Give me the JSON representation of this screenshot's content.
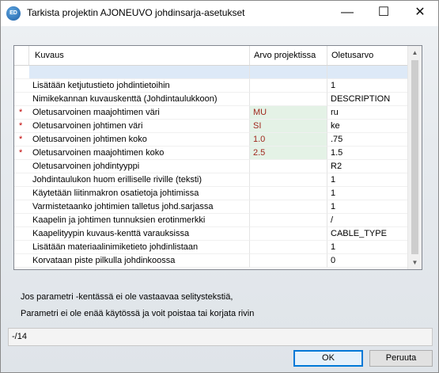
{
  "window": {
    "app_icon_text": "ED",
    "title": "Tarkista projektin AJONEUVO johdinsarja-asetukset",
    "minimize_glyph": "—",
    "maximize_glyph": "☐",
    "close_glyph": "✕"
  },
  "grid": {
    "headers": [
      "Kuvaus",
      "Arvo projektissa",
      "Oletusarvo"
    ],
    "rows": [
      {
        "flag": "",
        "desc": "",
        "project": "",
        "default": "",
        "modified": false
      },
      {
        "flag": "",
        "desc": "Lisätään ketjutustieto johdintietoihin",
        "project": "",
        "default": "1",
        "modified": false
      },
      {
        "flag": "",
        "desc": "Nimikekannan kuvauskenttä (Johdintaulukkoon)",
        "project": "",
        "default": "DESCRIPTION",
        "modified": false
      },
      {
        "flag": "*",
        "desc": "Oletusarvoinen maajohtimen väri",
        "project": "MU",
        "default": "ru",
        "modified": true
      },
      {
        "flag": "*",
        "desc": "Oletusarvoinen johtimen väri",
        "project": "SI",
        "default": "ke",
        "modified": true
      },
      {
        "flag": "*",
        "desc": "Oletusarvoinen johtimen koko",
        "project": "1.0",
        "default": ".75",
        "modified": true
      },
      {
        "flag": "*",
        "desc": "Oletusarvoinen maajohtimen koko",
        "project": "2.5",
        "default": "1.5",
        "modified": true
      },
      {
        "flag": "",
        "desc": "Oletusarvoinen johdintyyppi",
        "project": "",
        "default": "R2",
        "modified": false
      },
      {
        "flag": "",
        "desc": "Johdintaulukon huom erilliselle riville (teksti)",
        "project": "",
        "default": "1",
        "modified": false
      },
      {
        "flag": "",
        "desc": "Käytetään liitinmakron osatietoja johtimissa",
        "project": "",
        "default": "1",
        "modified": false
      },
      {
        "flag": "",
        "desc": "Varmistetaanko johtimien talletus johd.sarjassa",
        "project": "",
        "default": "1",
        "modified": false
      },
      {
        "flag": "",
        "desc": "Kaapelin ja johtimen tunnuksien erotinmerkki",
        "project": "",
        "default": "/",
        "modified": false
      },
      {
        "flag": "",
        "desc": "Kaapelityypin kuvaus-kenttä varauksissa",
        "project": "",
        "default": "CABLE_TYPE",
        "modified": false
      },
      {
        "flag": "",
        "desc": "Lisätään materiaalinimiketieto johdinlistaan",
        "project": "",
        "default": "1",
        "modified": false
      },
      {
        "flag": "",
        "desc": "Korvataan piste pilkulla johdinkoossa",
        "project": "",
        "default": "0",
        "modified": false
      }
    ]
  },
  "notes": {
    "line1": "Jos parametri -kentässä ei ole vastaavaa selitystekstiä,",
    "line2": "Parametri ei ole enää käytössä ja voit poistaa tai korjata rivin"
  },
  "status": {
    "text": "-/14"
  },
  "buttons": {
    "ok": "OK",
    "cancel": "Peruuta"
  },
  "colors": {
    "modified_bg": "#e4f2e6",
    "modified_text": "#a0281e",
    "flag": "#c00000",
    "selected_row": "#dde9f7"
  }
}
